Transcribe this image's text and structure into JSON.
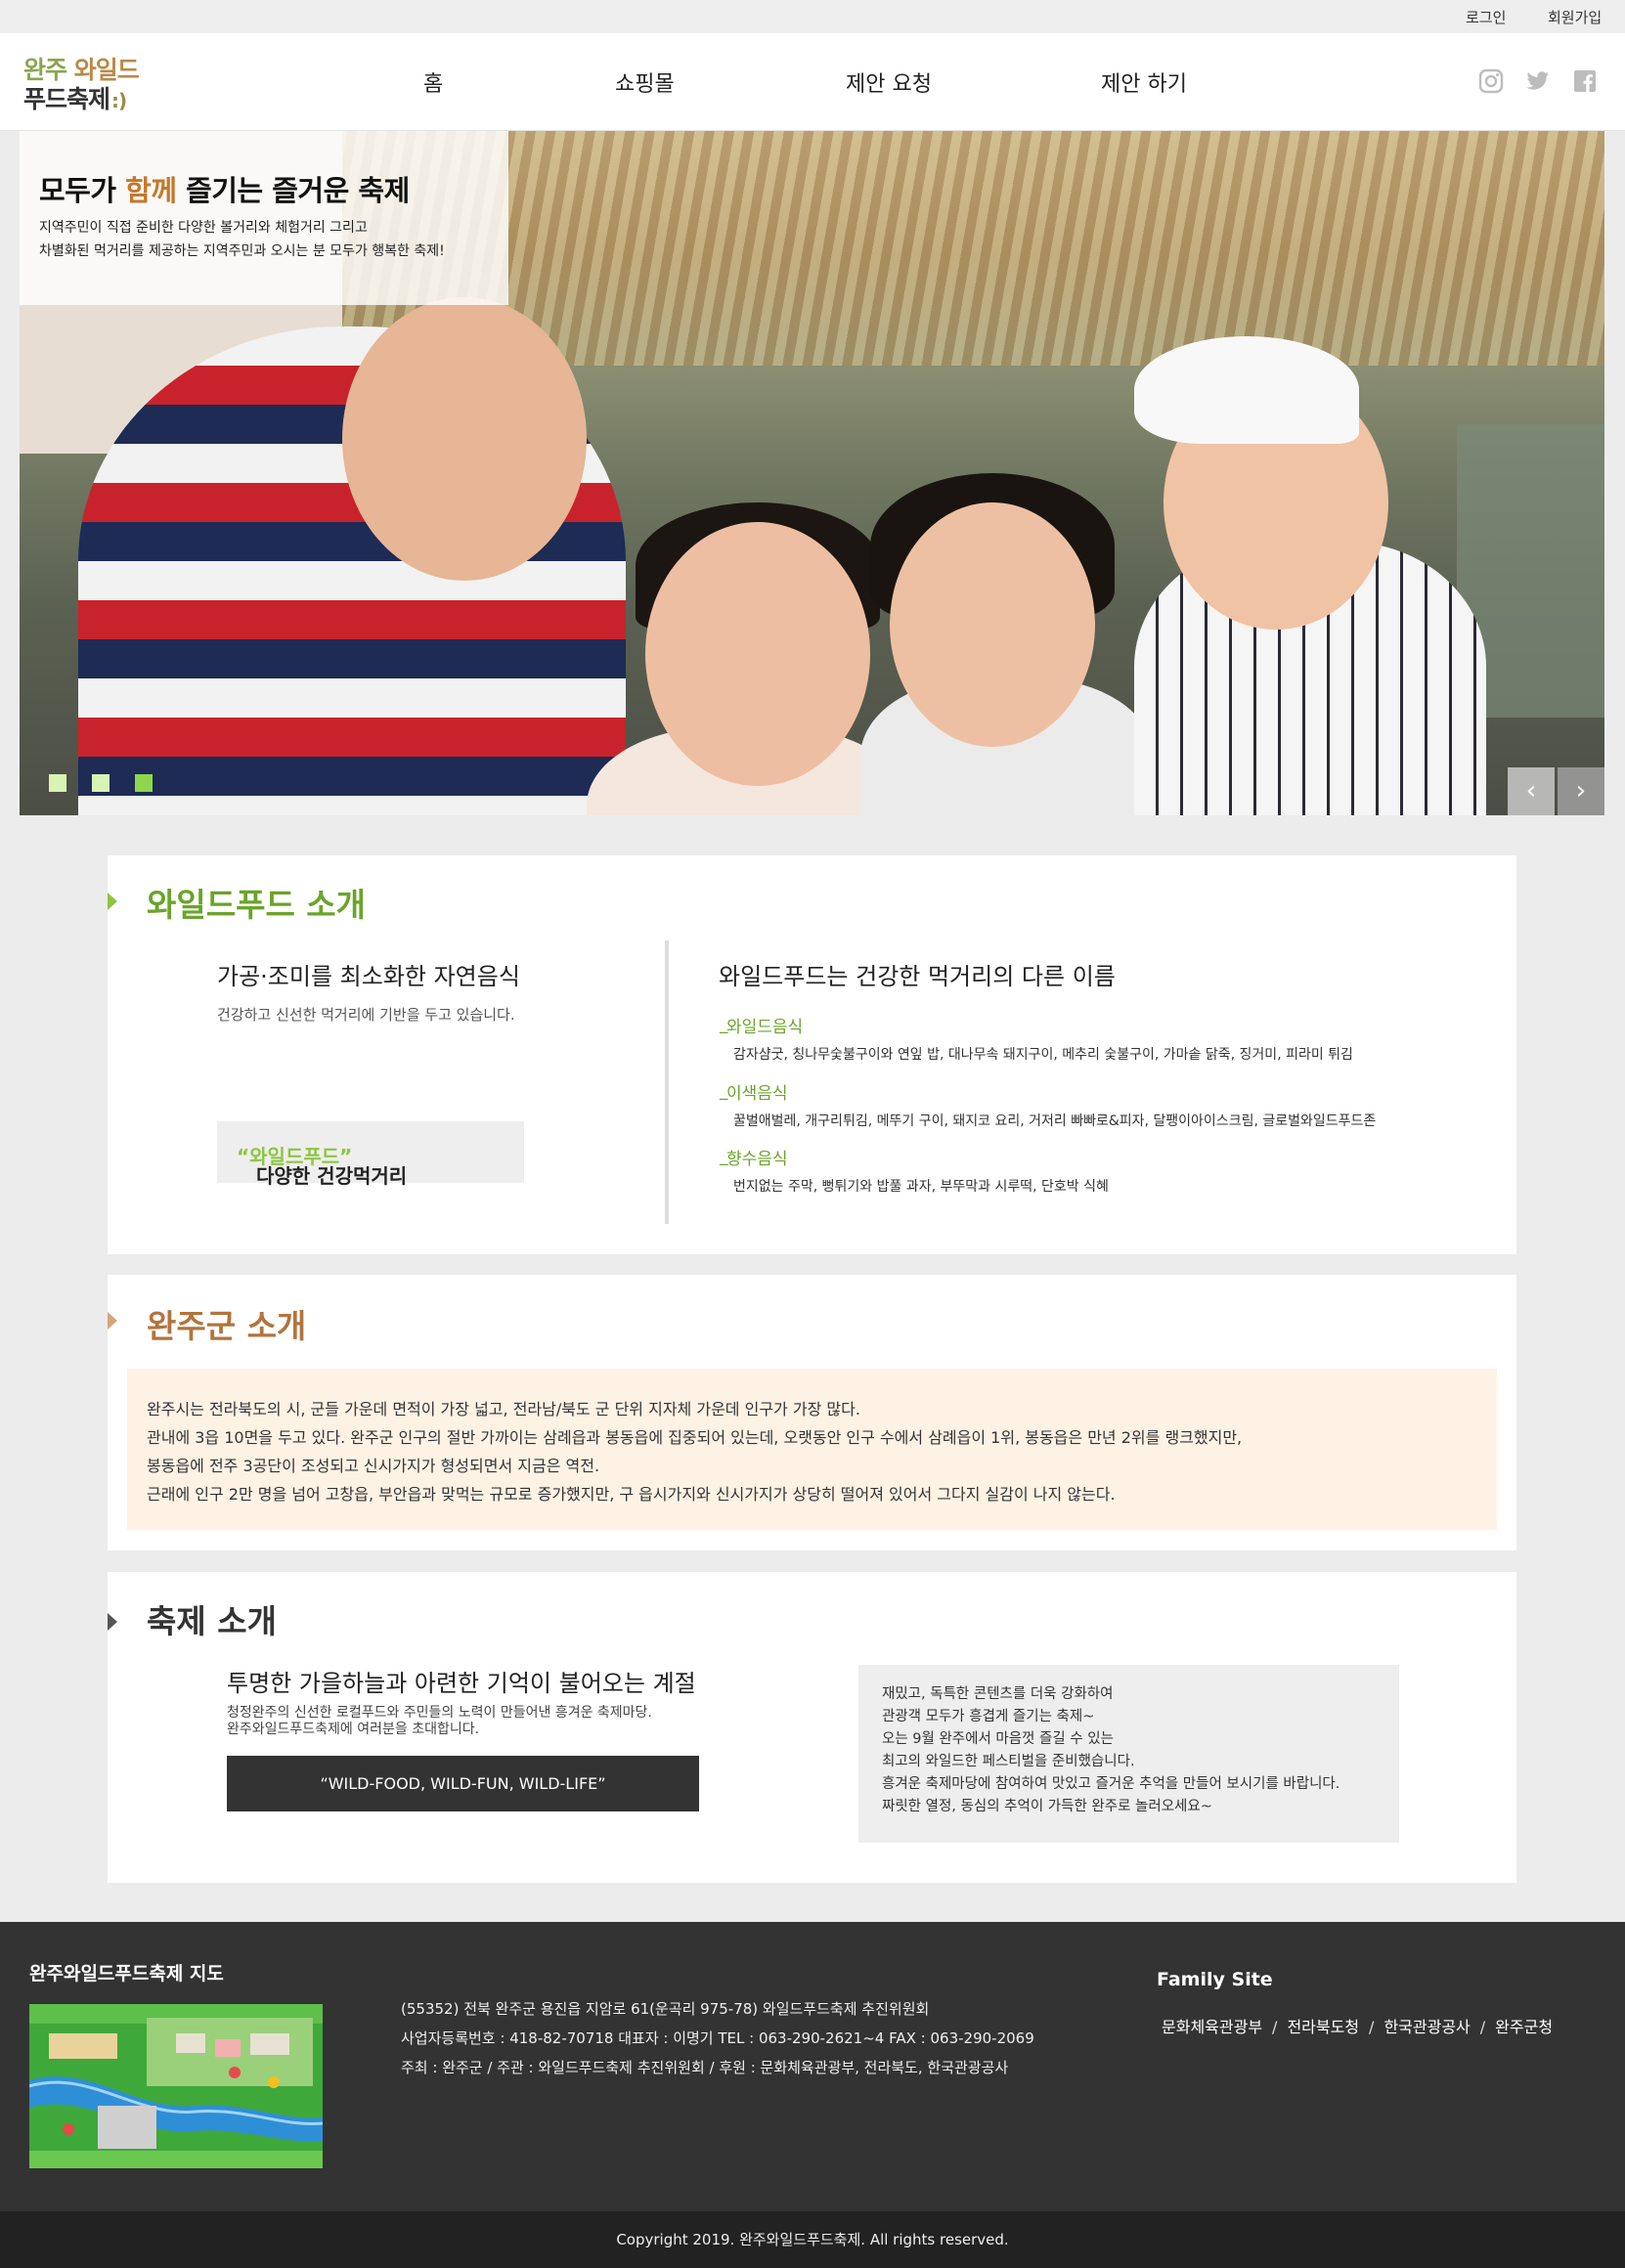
{
  "topbar": {
    "login": "로그인",
    "join": "회원가입"
  },
  "logo": {
    "line1_a": "완주",
    "line1_b": "와일드",
    "line2": "푸드축제",
    "smile": ":)"
  },
  "nav": [
    "홈",
    "쇼핑몰",
    "제안 요청",
    "제안 하기"
  ],
  "social": [
    "instagram-icon",
    "twitter-icon",
    "facebook-icon"
  ],
  "hero": {
    "title_pre": "모두가 ",
    "title_accent": "함께",
    "title_post": " 즐기는 즐거운 축제",
    "desc1": "지역주민이 직접 준비한 다양한 볼거리와 체험거리 그리고",
    "desc2": "차별화된 먹거리를 제공하는 지역주민과 오시는 분 모두가 행복한 축제!",
    "slides": 3,
    "active_slide": 3,
    "prev": "‹",
    "next": "›"
  },
  "wildfood": {
    "title": "와일드푸드 소개",
    "left_heading": "가공·조미를 최소화한 자연음식",
    "left_desc": "건강하고 신선한 먹거리에 기반을 두고 있습니다.",
    "pill_pre": "다양한 건강먹거리 ",
    "pill_accent": "“와일드푸드”",
    "right_heading": "와일드푸드는 건강한 먹거리의 다른 이름",
    "categories": [
      {
        "name": "와일드음식",
        "items": "감자샴굿, 칭나무숯불구이와 연잎 밥, 대나무속 돼지구이, 메추리 숯불구이, 가마솥 닭죽, 징거미, 피라미 튀김"
      },
      {
        "name": "이색음식",
        "items": "꿀벌애벌레, 개구리튀김, 메뚜기 구이, 돼지코 요리, 거저리 빠빠로&피자, 달팽이아이스크림, 글로벌와일드푸드존"
      },
      {
        "name": "향수음식",
        "items": "번지없는 주막, 뻥튀기와 밥풀 과자, 부뚜막과 시루떡, 단호박 식혜"
      }
    ]
  },
  "wanju": {
    "title": "완주군 소개",
    "lines": [
      "완주시는 전라북도의 시, 군들 가운데 면적이 가장 넓고, 전라남/북도 군 단위 지자체 가운데 인구가 가장 많다.",
      "관내에 3읍 10면을 두고 있다. 완주군 인구의 절반 가까이는 삼례읍과 봉동읍에 집중되어 있는데, 오랫동안 인구 수에서 삼례읍이 1위, 봉동읍은 만년 2위를 랭크했지만,",
      "봉동읍에 전주 3공단이 조성되고 신시가지가 형성되면서 지금은 역전.",
      "근래에 인구 2만 명을 넘어 고창읍, 부안읍과 맞먹는 규모로 증가했지만, 구 읍시가지와 신시가지가 상당히 떨어져 있어서 그다지 실감이 나지 않는다."
    ]
  },
  "festival": {
    "title": "축제 소개",
    "heading": "투명한 가을하늘과 아련한 기억이 불어오는 계절",
    "desc1": "청정완주의 신선한 로컬푸드와 주민들의 노력이 만들어낸 흥겨운 축제마당.",
    "desc2": "완주와일드푸드축제에 여러분을 초대합니다.",
    "slogan": "“WILD-FOOD, WILD-FUN, WILD-LIFE”",
    "box": [
      "재밌고, 독특한 콘텐츠를 더욱 강화하여",
      "관광객 모두가 흥겹게 즐기는 축제~",
      "오는 9월 완주에서 마음껏 즐길 수 있는",
      "최고의 와일드한 페스티벌을 준비했습니다.",
      "흥겨운 축제마당에 참여하여 맛있고 즐거운 추억을 만들어 보시기를 바랍니다.",
      "짜릿한 열정, 동심의 추억이 가득한 완주로 놀러오세요~"
    ]
  },
  "footer": {
    "map_title": "완주와일드푸드축제 지도",
    "address": [
      "(55352) 전북 완주군 용진읍 지암로 61(운곡리 975-78) 와일드푸드축제 추진위원회",
      "사업자등록번호 : 418-82-70718 대표자 : 이명기 TEL : 063-290-2621~4 FAX : 063-290-2069",
      "주최 : 완주군 / 주관 : 와일드푸드축제 추진위원회 / 후원 : 문화체육관광부, 전라북도, 한국관광공사"
    ],
    "family_title": "Family Site",
    "family_links": [
      "문화체육관광부",
      "전라북도청",
      "한국관광공사",
      "완주군청"
    ],
    "sep": "/",
    "copyright": "Copyright 2019. 완주와일드푸드축제. All rights reserved."
  },
  "colors": {
    "accent_green": "#6aa42a",
    "accent_brown": "#b2743c",
    "hero_accent": "#c4782a",
    "footer_bg": "#333333"
  }
}
